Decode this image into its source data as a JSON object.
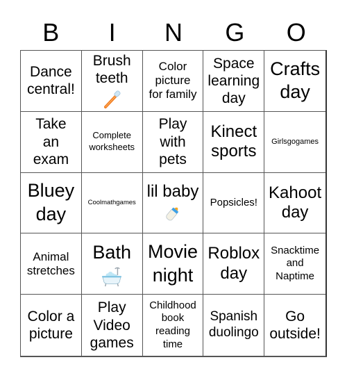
{
  "header": {
    "letters": [
      "B",
      "I",
      "N",
      "G",
      "O"
    ]
  },
  "cells": [
    {
      "text": "Dance\ncentral!",
      "size": "m"
    },
    {
      "text": "Brush\nteeth",
      "size": "m",
      "icon": "toothbrush-icon"
    },
    {
      "text": "Color\npicture\nfor family",
      "size": "s"
    },
    {
      "text": "Space\nlearning\nday",
      "size": "m"
    },
    {
      "text": "Crafts\nday",
      "size": "xl"
    },
    {
      "text": "Take\nan\nexam",
      "size": "m"
    },
    {
      "text": "Complete\nworksheets",
      "size": "xxs"
    },
    {
      "text": "Play\nwith\npets",
      "size": "m"
    },
    {
      "text": "Kinect\nsports",
      "size": "l"
    },
    {
      "text": "Girlsgogames",
      "size": "t"
    },
    {
      "text": "Bluey\nday",
      "size": "xl"
    },
    {
      "text": "Coolmathgames",
      "size": "tt"
    },
    {
      "text": "lil baby",
      "size": "l",
      "icon": "baby-bottle-icon"
    },
    {
      "text": "Popsicles!",
      "size": "xs"
    },
    {
      "text": "Kahoot\nday",
      "size": "l"
    },
    {
      "text": "Animal\nstretches",
      "size": "s"
    },
    {
      "text": "Bath",
      "size": "xl",
      "icon": "bathtub-icon"
    },
    {
      "text": "Movie\nnight",
      "size": "xl"
    },
    {
      "text": "Roblox\nday",
      "size": "l"
    },
    {
      "text": "Snacktime\nand\nNaptime",
      "size": "xs"
    },
    {
      "text": "Color a\npicture",
      "size": "m"
    },
    {
      "text": "Play\nVideo\ngames",
      "size": "m"
    },
    {
      "text": "Childhood\nbook\nreading\ntime",
      "size": "xs"
    },
    {
      "text": "Spanish\nduolingo",
      "size": "ms"
    },
    {
      "text": "Go\noutside!",
      "size": "m"
    }
  ]
}
